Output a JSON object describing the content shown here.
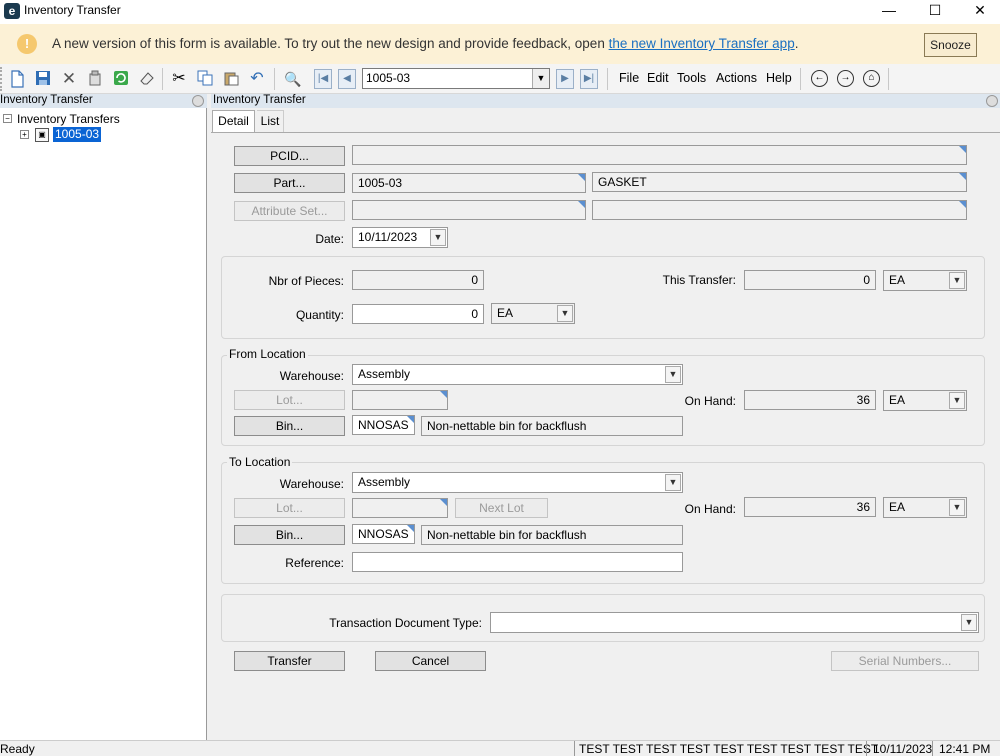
{
  "window": {
    "title": "Inventory Transfer",
    "app_icon_letter": "e",
    "minimize_glyph": "—",
    "maximize_glyph": "☐",
    "close_glyph": "✕"
  },
  "banner": {
    "icon_glyph": "!",
    "text": "A new version of this form is available. To try out the new design and provide feedback, open ",
    "link_text": "the new Inventory Transfer app",
    "suffix": ".",
    "snooze_label": "Snooze"
  },
  "toolbar": {
    "record_value": "1005-03",
    "menus": [
      "File",
      "Edit",
      "Tools",
      "Actions",
      "Help"
    ]
  },
  "tree": {
    "panel_title": "Inventory Transfer",
    "root_label": "Inventory Transfers",
    "child_label": "1005-03"
  },
  "form": {
    "panel_title": "Inventory Transfer",
    "tabs": [
      "Detail",
      "List"
    ],
    "pcid_button": "PCID...",
    "pcid_value": "",
    "part_button": "Part...",
    "part_value": "1005-03",
    "part_description": "GASKET",
    "attribute_button": "Attribute Set...",
    "attribute_value": "",
    "attribute_description": "",
    "date_label": "Date:",
    "date_value": "10/11/2023",
    "nbr_pieces_label": "Nbr of Pieces:",
    "nbr_pieces_value": "0",
    "this_transfer_label": "This Transfer:",
    "this_transfer_value": "0",
    "this_transfer_uom": "EA",
    "quantity_label": "Quantity:",
    "quantity_value": "0",
    "quantity_uom": "EA"
  },
  "from_location": {
    "title": "From Location",
    "warehouse_label": "Warehouse:",
    "warehouse_value": "Assembly",
    "lot_button": "Lot...",
    "lot_value": "",
    "on_hand_label": "On Hand:",
    "on_hand_value": "36",
    "on_hand_uom": "EA",
    "bin_button": "Bin...",
    "bin_value": "NNOSAS",
    "bin_description": "Non-nettable bin for backflush"
  },
  "to_location": {
    "title": "To Location",
    "warehouse_label": "Warehouse:",
    "warehouse_value": "Assembly",
    "lot_button": "Lot...",
    "lot_value": "",
    "next_lot_button": "Next Lot",
    "on_hand_label": "On Hand:",
    "on_hand_value": "36",
    "on_hand_uom": "EA",
    "bin_button": "Bin...",
    "bin_value": "NNOSAS",
    "bin_description": "Non-nettable bin for backflush",
    "reference_label": "Reference:",
    "reference_value": ""
  },
  "transaction": {
    "doc_type_label": "Transaction Document Type:",
    "doc_type_value": ""
  },
  "actions": {
    "transfer": "Transfer",
    "cancel": "Cancel",
    "serial_numbers": "Serial Numbers..."
  },
  "status": {
    "state": "Ready",
    "user": "TEST TEST TEST TEST TEST TEST TEST TEST TEST",
    "date": "10/11/2023",
    "time": "12:41 PM"
  }
}
